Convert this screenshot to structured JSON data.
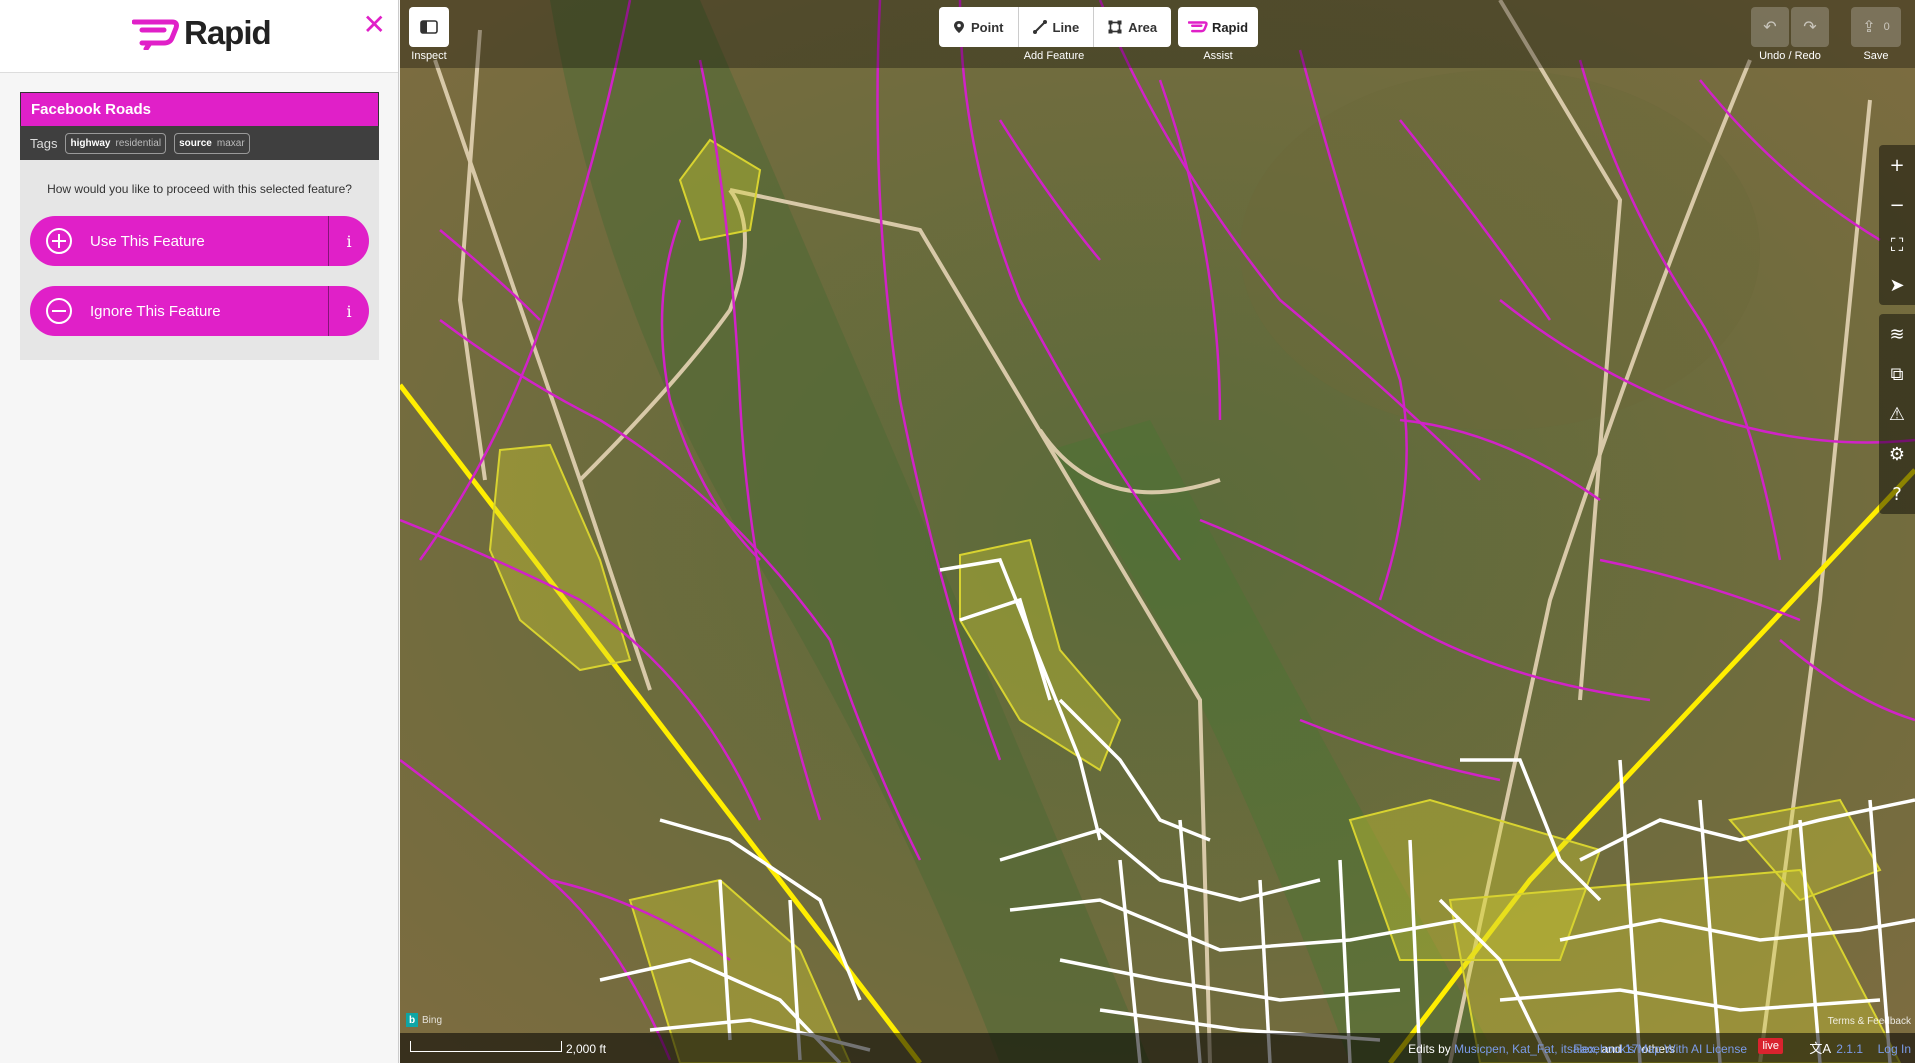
{
  "brand": {
    "name": "Rapid",
    "color": "#e020c8"
  },
  "sidebar": {
    "close_icon": "close-icon",
    "feature": {
      "title": "Facebook Roads",
      "tags_label": "Tags",
      "tags": [
        {
          "key": "highway",
          "value": "residential"
        },
        {
          "key": "source",
          "value": "maxar"
        }
      ],
      "question": "How would you like to proceed with this selected feature?",
      "actions": [
        {
          "label": "Use This Feature",
          "icon": "plus-circle-icon",
          "info": "i"
        },
        {
          "label": "Ignore This Feature",
          "icon": "minus-circle-icon",
          "info": "i"
        }
      ]
    }
  },
  "toolbar": {
    "inspect_label": "Inspect",
    "add_feature_label": "Add Feature",
    "modes": [
      {
        "label": "Point",
        "icon": "point-icon"
      },
      {
        "label": "Line",
        "icon": "line-icon"
      },
      {
        "label": "Area",
        "icon": "area-icon"
      }
    ],
    "assist_button": "Rapid",
    "assist_label": "Assist",
    "undo_redo_label": "Undo / Redo",
    "save_label": "Save",
    "save_count": "0"
  },
  "map_controls": [
    "zoom-in-icon",
    "zoom-out-icon",
    "zoom-to-selection-icon",
    "geolocate-icon",
    "layers-icon",
    "map-data-icon",
    "issues-icon",
    "preferences-icon",
    "help-icon"
  ],
  "footer": {
    "scale": "2,000 ft",
    "edits_prefix": "Edits by",
    "editors": "Musicpen, Kat_Fat, itsalex,",
    "and": "and",
    "others_count": "17",
    "others_label": "others",
    "license": "Facebook's Map With AI License",
    "live": "live",
    "version": "2.1.1",
    "login": "Log In",
    "imagery": "Bing",
    "terms": "Terms & Feedback"
  }
}
